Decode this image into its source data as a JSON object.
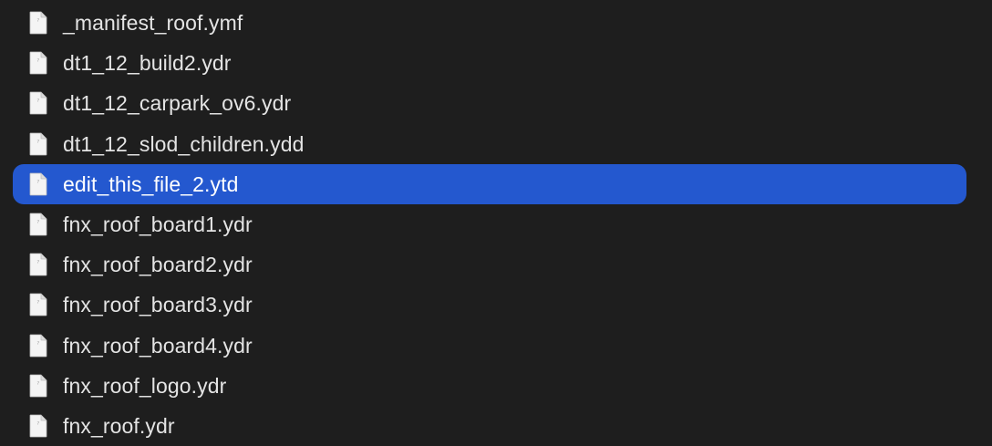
{
  "files": [
    {
      "name": "_manifest_roof.ymf",
      "selected": false
    },
    {
      "name": "dt1_12_build2.ydr",
      "selected": false
    },
    {
      "name": "dt1_12_carpark_ov6.ydr",
      "selected": false
    },
    {
      "name": "dt1_12_slod_children.ydd",
      "selected": false
    },
    {
      "name": "edit_this_file_2.ytd",
      "selected": true
    },
    {
      "name": "fnx_roof_board1.ydr",
      "selected": false
    },
    {
      "name": "fnx_roof_board2.ydr",
      "selected": false
    },
    {
      "name": "fnx_roof_board3.ydr",
      "selected": false
    },
    {
      "name": "fnx_roof_board4.ydr",
      "selected": false
    },
    {
      "name": "fnx_roof_logo.ydr",
      "selected": false
    },
    {
      "name": "fnx_roof.ydr",
      "selected": false
    }
  ],
  "icon": "generic-document-icon",
  "colors": {
    "background": "#1e1e1e",
    "selection": "#2458cf",
    "text": "#e4e4e4",
    "selected_text": "#ffffff"
  }
}
